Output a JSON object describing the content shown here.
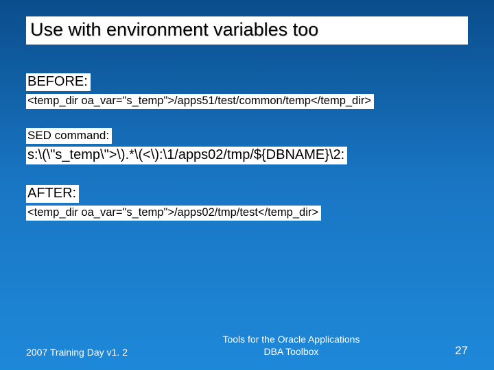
{
  "title": "Use with environment variables too",
  "before": {
    "label": "BEFORE:",
    "code": "<temp_dir oa_var=\"s_temp\">/apps51/test/common/temp</temp_dir>"
  },
  "sed": {
    "label": "SED command:",
    "code": "s:\\(\\\"s_temp\\\">\\).*\\(<\\):\\1/apps02/tmp/${DBNAME}\\2:"
  },
  "after": {
    "label": "AFTER:",
    "code": "<temp_dir oa_var=\"s_temp\">/apps02/tmp/test</temp_dir>"
  },
  "footer": {
    "left": "2007 Training Day v1. 2",
    "center_line1": "Tools for the Oracle Applications",
    "center_line2": "DBA Toolbox",
    "page": "27"
  }
}
